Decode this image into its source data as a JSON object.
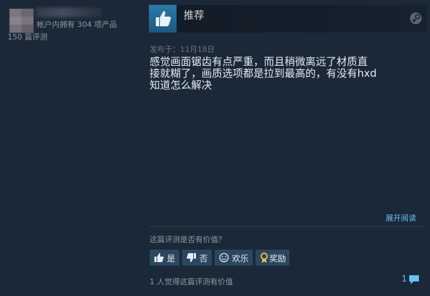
{
  "author": {
    "products_owned": "帐户内拥有 304 项产品",
    "reviews_count": "150 篇评测"
  },
  "review": {
    "verdict": "推荐",
    "posted_date": "发布于：11月18日",
    "body_lines": [
      "感觉画面锯齿有点严重，而且稍微离远了材质直",
      "接就糊了，画质选项都是拉到最高的，有没有hxd",
      "知道怎么解决"
    ],
    "expand_label": "展开阅读"
  },
  "feedback": {
    "question": "这篇评测是否有价值？",
    "buttons": {
      "yes": "是",
      "no": "否",
      "funny": "欢乐",
      "award": "奖励"
    },
    "helpful_summary": "1 人觉得这篇评测有价值",
    "comment_count": "1"
  },
  "colors": {
    "background": "#1b2838",
    "accent": "#67c1f5",
    "button_bg": "#2a475e",
    "thumb_bg": "#1b5a82"
  },
  "icons": [
    "thumbs-up-icon",
    "steam-logo-icon",
    "thumbs-down-icon",
    "smiley-icon",
    "award-icon",
    "comment-icon"
  ]
}
